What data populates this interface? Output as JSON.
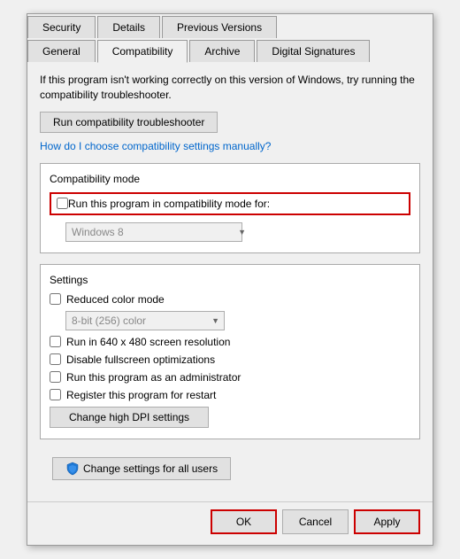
{
  "dialog": {
    "tabs_row1": [
      {
        "label": "Security",
        "active": false
      },
      {
        "label": "Details",
        "active": false
      },
      {
        "label": "Previous Versions",
        "active": false
      }
    ],
    "tabs_row2": [
      {
        "label": "General",
        "active": false
      },
      {
        "label": "Compatibility",
        "active": true
      },
      {
        "label": "Archive",
        "active": false
      },
      {
        "label": "Digital Signatures",
        "active": false
      }
    ],
    "description": "If this program isn't working correctly on this version of Windows, try running the compatibility troubleshooter.",
    "run_btn": "Run compatibility troubleshooter",
    "help_link": "How do I choose compatibility settings manually?",
    "compat_mode_section_title": "Compatibility mode",
    "compat_checkbox_label": "Run this program in compatibility mode for:",
    "windows_version": "Windows 8",
    "settings_section_title": "Settings",
    "settings_checkboxes": [
      {
        "label": "Reduced color mode",
        "checked": false
      },
      {
        "label": "Run in 640 x 480 screen resolution",
        "checked": false
      },
      {
        "label": "Disable fullscreen optimizations",
        "checked": false
      },
      {
        "label": "Run this program as an administrator",
        "checked": false
      },
      {
        "label": "Register this program for restart",
        "checked": false
      }
    ],
    "color_mode_option": "8-bit (256) color",
    "change_dpi_btn": "Change high DPI settings",
    "change_all_users_btn": "Change settings for all users",
    "ok_btn": "OK",
    "cancel_btn": "Cancel",
    "apply_btn": "Apply"
  }
}
